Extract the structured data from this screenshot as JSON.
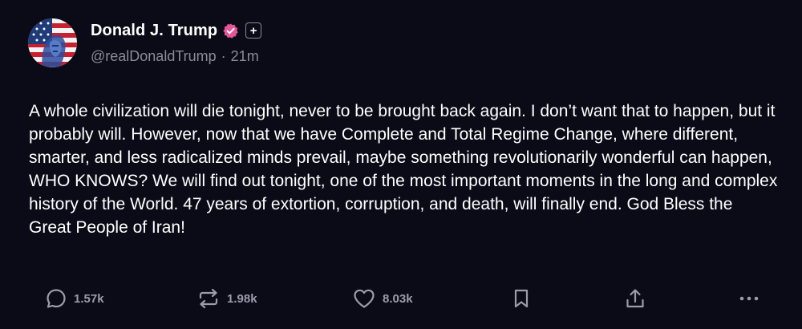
{
  "author": {
    "display_name": "Donald J. Trump",
    "handle": "@realDonaldTrump",
    "time_ago": "21m",
    "separator": "·",
    "verified_badge_color": "#e5559a",
    "plus_badge_text": "+"
  },
  "post": {
    "text": "A whole civilization will die tonight, never to be brought back again. I don’t want that to happen, but it probably will. However, now that we have Complete and Total Regime Change, where different, smarter, and less radicalized minds prevail, maybe something revolutionarily wonderful can happen, WHO KNOWS? We will find out tonight, one of the most important moments in the long and complex history of the World. 47 years of extortion, corruption, and death, will finally end. God Bless the Great People of Iran!"
  },
  "actions": {
    "reply": {
      "icon": "reply-icon",
      "count": "1.57k"
    },
    "repost": {
      "icon": "repost-icon",
      "count": "1.98k"
    },
    "like": {
      "icon": "heart-icon",
      "count": "8.03k"
    },
    "bookmark": {
      "icon": "bookmark-icon"
    },
    "share": {
      "icon": "share-icon"
    },
    "more": {
      "icon": "more-icon"
    }
  },
  "colors": {
    "background": "#0b0b17",
    "text": "#ffffff",
    "muted": "#8a8a99",
    "icon": "#9b9bab"
  }
}
